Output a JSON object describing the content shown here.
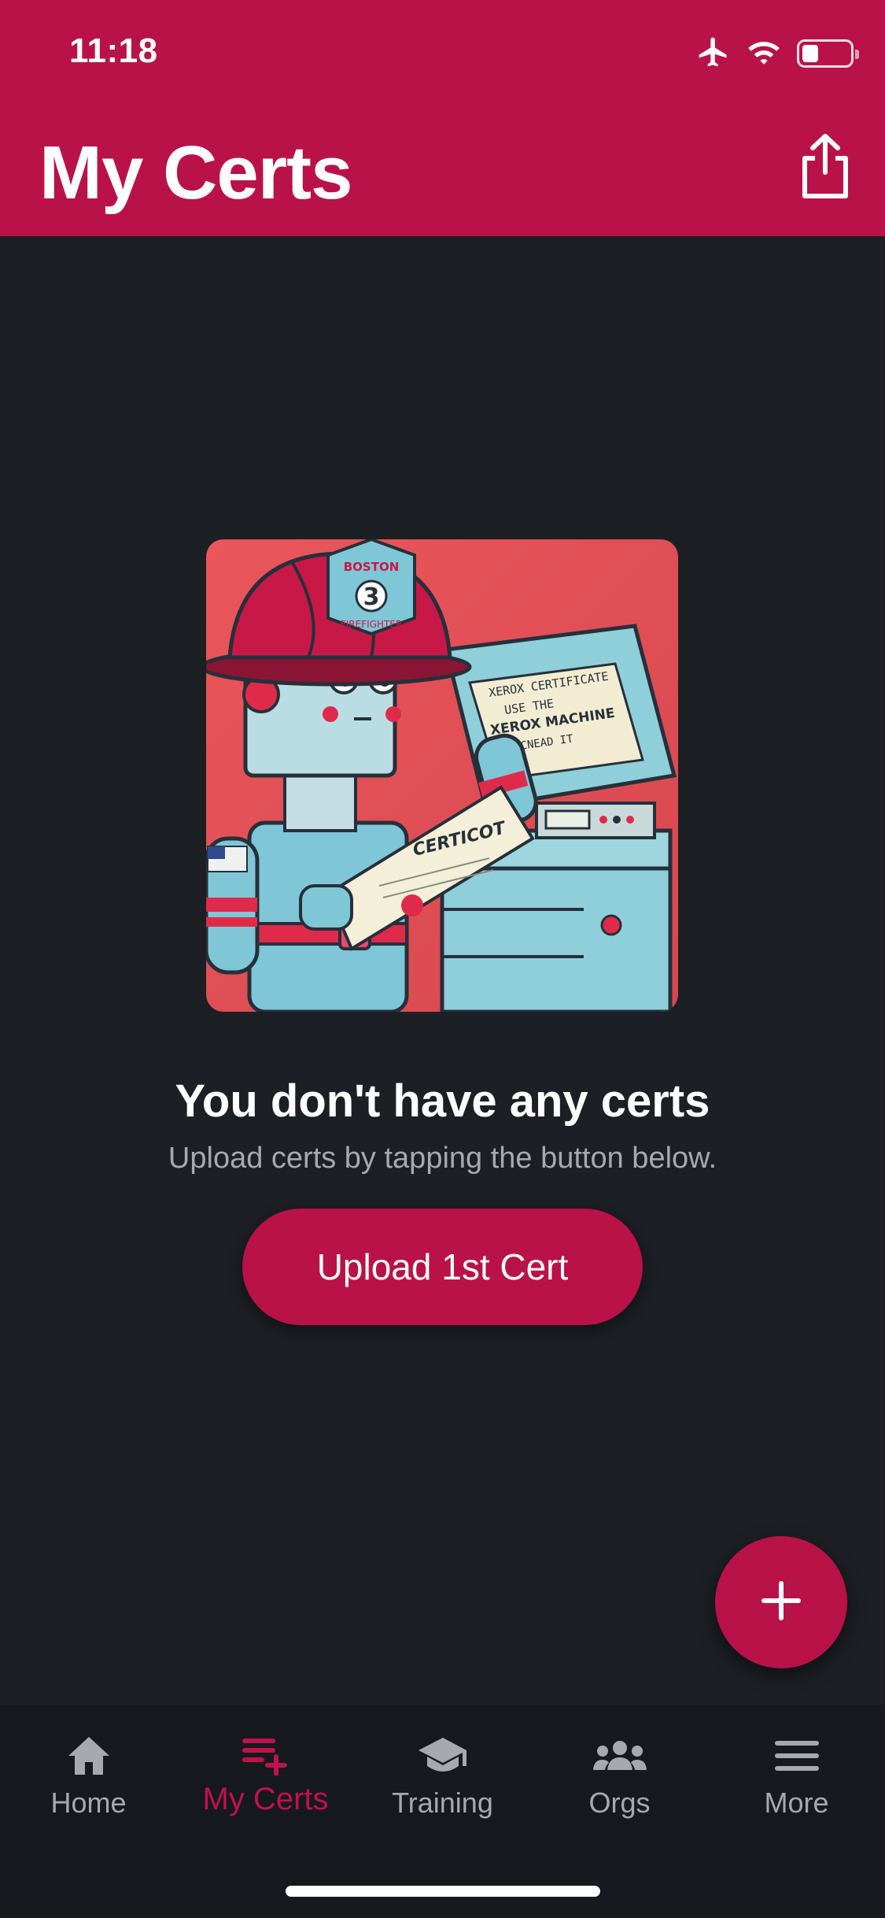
{
  "status_bar": {
    "time": "11:18",
    "icons": [
      "airplane-icon",
      "wifi-icon",
      "battery-icon"
    ],
    "battery_level_fraction": 0.34
  },
  "header": {
    "title": "My Certs",
    "share_icon": "share-icon",
    "background_color": "#b91248"
  },
  "empty_state": {
    "image_text": {
      "helmet_top": "BOSTON",
      "helmet_number": "3",
      "helmet_bottom": "FIREFIGHTER",
      "certificate": "CERTICOT",
      "scanner_sign": [
        "XEROX CERTIFICATE",
        "USE THE",
        "XEROX MACHINE",
        "SCNEAD IT"
      ]
    },
    "title": "You don't have any certs",
    "subtitle": "Upload certs by tapping the button below.",
    "button_label": "Upload 1st Cert"
  },
  "fab": {
    "icon": "plus-icon"
  },
  "bottom_nav": {
    "items": [
      {
        "label": "Home",
        "icon": "home-icon",
        "active": false
      },
      {
        "label": "My Certs",
        "icon": "playlist-add-icon",
        "active": true
      },
      {
        "label": "Training",
        "icon": "graduation-cap-icon",
        "active": false
      },
      {
        "label": "Orgs",
        "icon": "group-icon",
        "active": false
      },
      {
        "label": "More",
        "icon": "menu-icon",
        "active": false
      }
    ]
  },
  "colors": {
    "accent": "#b91248",
    "background": "#1c1f23",
    "nav_background": "#16191d",
    "muted_text": "#a6a9ae"
  }
}
